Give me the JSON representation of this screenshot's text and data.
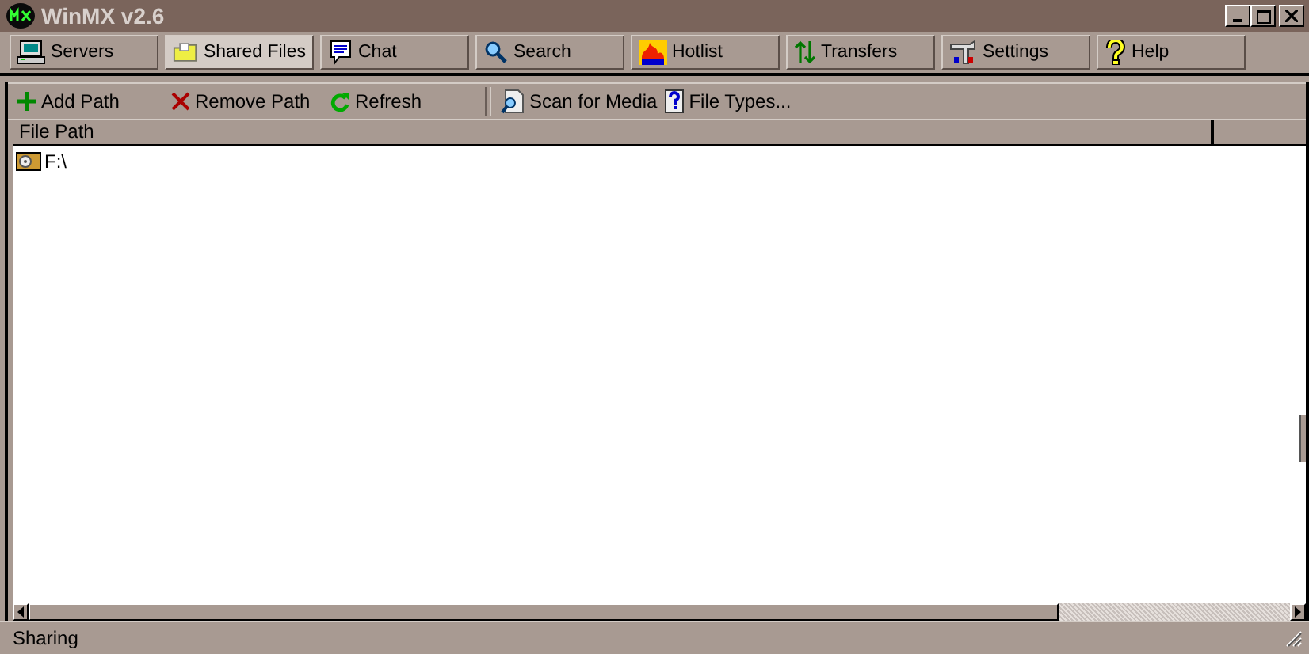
{
  "window": {
    "title": "WinMX v2.6"
  },
  "tabs": [
    {
      "label": "Servers",
      "selected": false
    },
    {
      "label": "Shared Files",
      "selected": true
    },
    {
      "label": "Chat",
      "selected": false
    },
    {
      "label": "Search",
      "selected": false
    },
    {
      "label": "Hotlist",
      "selected": false
    },
    {
      "label": "Transfers",
      "selected": false
    },
    {
      "label": "Settings",
      "selected": false
    },
    {
      "label": "Help",
      "selected": false
    }
  ],
  "toolbar": [
    {
      "label": "Add Path"
    },
    {
      "label": "Remove Path"
    },
    {
      "label": "Refresh"
    },
    {
      "label": "Scan for Media"
    },
    {
      "label": "File Types..."
    }
  ],
  "table": {
    "columns": [
      "File Path"
    ],
    "rows": [
      {
        "path": "F:\\"
      }
    ]
  },
  "status_bar": {
    "text": "Sharing"
  }
}
